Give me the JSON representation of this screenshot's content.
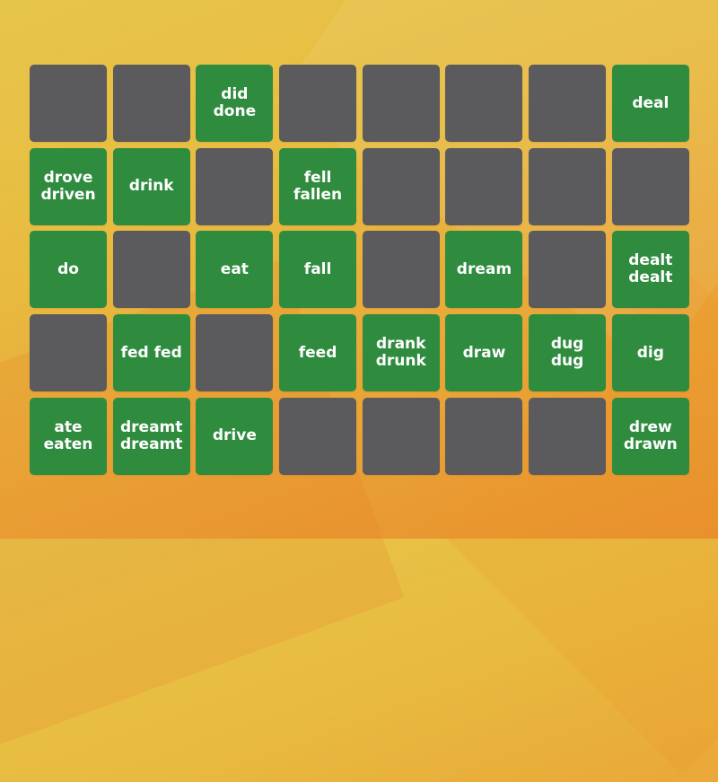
{
  "colors": {
    "hidden_tile": "#5b5a5c",
    "revealed_tile": "#2f8c3f",
    "text": "#ffffff",
    "background": "#e8b63e"
  },
  "board": {
    "rows": 5,
    "columns": 8,
    "tiles": [
      {
        "label": "",
        "state": "hidden"
      },
      {
        "label": "",
        "state": "hidden"
      },
      {
        "label": "did\ndone",
        "state": "revealed"
      },
      {
        "label": "",
        "state": "hidden"
      },
      {
        "label": "",
        "state": "hidden"
      },
      {
        "label": "",
        "state": "hidden"
      },
      {
        "label": "",
        "state": "hidden"
      },
      {
        "label": "deal",
        "state": "revealed"
      },
      {
        "label": "drove\ndriven",
        "state": "revealed"
      },
      {
        "label": "drink",
        "state": "revealed"
      },
      {
        "label": "",
        "state": "hidden"
      },
      {
        "label": "fell\nfallen",
        "state": "revealed"
      },
      {
        "label": "",
        "state": "hidden"
      },
      {
        "label": "",
        "state": "hidden"
      },
      {
        "label": "",
        "state": "hidden"
      },
      {
        "label": "",
        "state": "hidden"
      },
      {
        "label": "do",
        "state": "revealed"
      },
      {
        "label": "",
        "state": "hidden"
      },
      {
        "label": "eat",
        "state": "revealed"
      },
      {
        "label": "fall",
        "state": "revealed"
      },
      {
        "label": "",
        "state": "hidden"
      },
      {
        "label": "dream",
        "state": "revealed"
      },
      {
        "label": "",
        "state": "hidden"
      },
      {
        "label": "dealt\ndealt",
        "state": "revealed"
      },
      {
        "label": "",
        "state": "hidden"
      },
      {
        "label": "fed fed",
        "state": "revealed"
      },
      {
        "label": "",
        "state": "hidden"
      },
      {
        "label": "feed",
        "state": "revealed"
      },
      {
        "label": "drank\ndrunk",
        "state": "revealed"
      },
      {
        "label": "draw",
        "state": "revealed"
      },
      {
        "label": "dug dug",
        "state": "revealed"
      },
      {
        "label": "dig",
        "state": "revealed"
      },
      {
        "label": "ate\neaten",
        "state": "revealed"
      },
      {
        "label": "dreamt\ndreamt",
        "state": "revealed"
      },
      {
        "label": "drive",
        "state": "revealed"
      },
      {
        "label": "",
        "state": "hidden"
      },
      {
        "label": "",
        "state": "hidden"
      },
      {
        "label": "",
        "state": "hidden"
      },
      {
        "label": "",
        "state": "hidden"
      },
      {
        "label": "drew\ndrawn",
        "state": "revealed"
      }
    ]
  }
}
